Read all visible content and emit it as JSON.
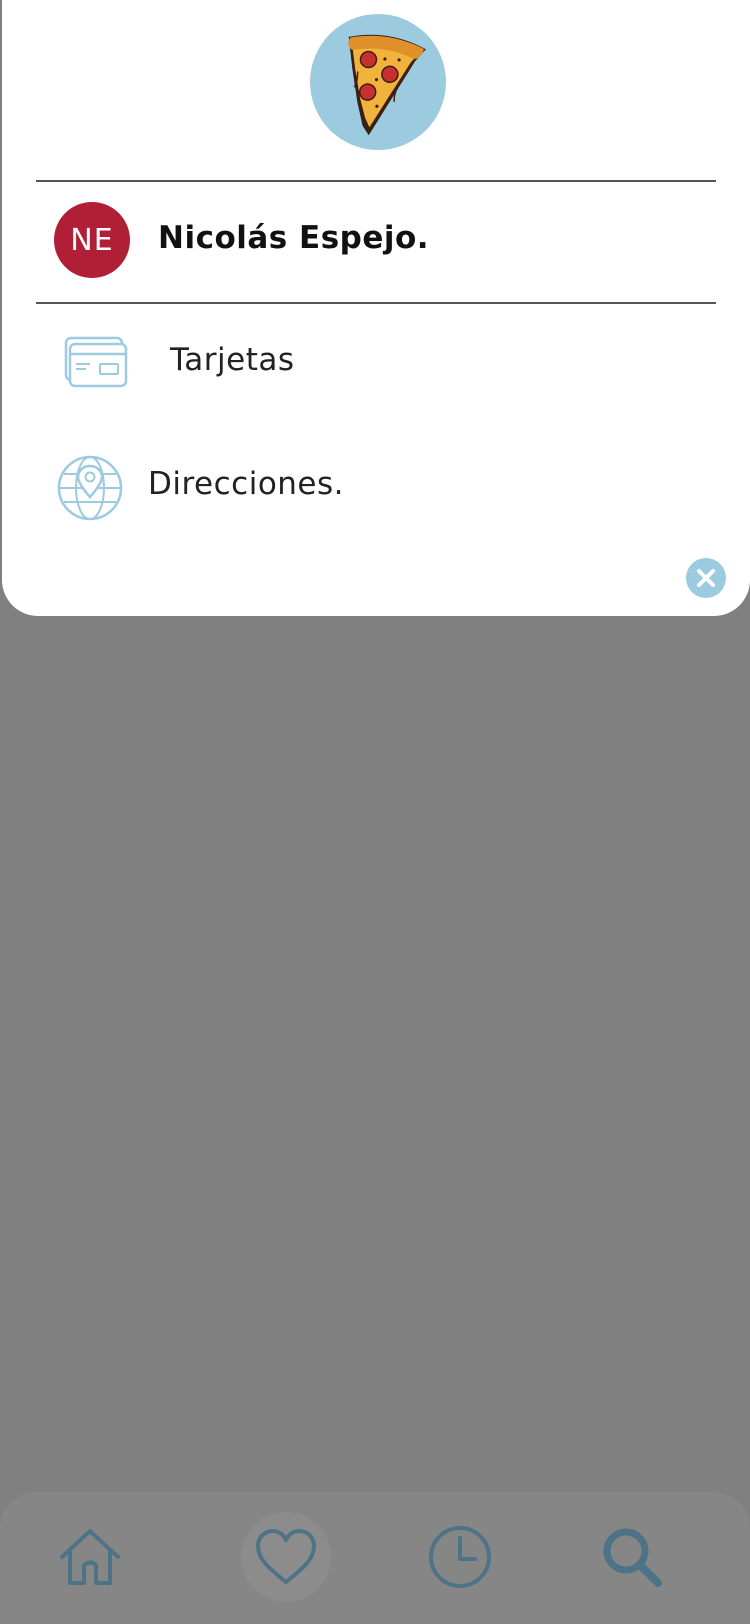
{
  "drawer": {
    "logo_icon": "pizza-slice-logo",
    "profile": {
      "initials": "NE",
      "name": "Nicolás Espejo.",
      "avatar_color": "#b01f35"
    },
    "menu": [
      {
        "icon": "credit-card-icon",
        "label": "Tarjetas"
      },
      {
        "icon": "globe-location-icon",
        "label": "Direcciones."
      }
    ],
    "close_icon": "close-icon"
  },
  "bottom_nav": {
    "items": [
      {
        "icon": "home-icon",
        "name": "home"
      },
      {
        "icon": "heart-icon",
        "name": "favorites",
        "active": true
      },
      {
        "icon": "clock-icon",
        "name": "history"
      },
      {
        "icon": "search-icon",
        "name": "search"
      }
    ]
  },
  "colors": {
    "accent": "#9ccadf",
    "overlay": "#808080",
    "nav_icon": "#4d7387"
  }
}
